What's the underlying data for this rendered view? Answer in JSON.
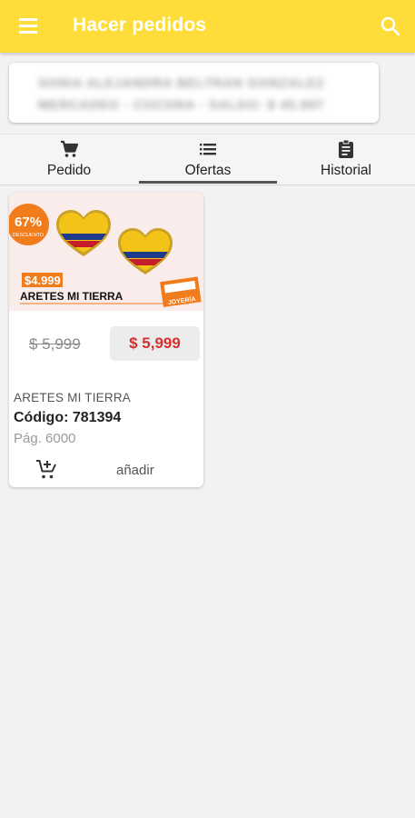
{
  "appbar": {
    "title": "Hacer pedidos",
    "color": "#fedd3a"
  },
  "user_card": {
    "line1": "SONIA ALEJANDRA BELTRAN GONZALEZ",
    "line2": "MERCADEO - COCONA - SALDO: $ 45.897"
  },
  "tabs": [
    {
      "label": "Pedido",
      "icon": "cart-icon"
    },
    {
      "label": "Ofertas",
      "icon": "list-icon",
      "active": true
    },
    {
      "label": "Historial",
      "icon": "clipboard-icon"
    }
  ],
  "product": {
    "discount_badge": "67%",
    "discount_sub": "DESCUENTO",
    "promo_price": "$4.999",
    "promo_title": "ARETES MI TIERRA",
    "sticker_text": "JOYERÍA",
    "old_price": "$ 5,999",
    "price": "$ 5,999",
    "name": "ARETES MI TIERRA",
    "code": "Código: 781394",
    "page": "Pág. 6000",
    "add_label": "añadir"
  }
}
